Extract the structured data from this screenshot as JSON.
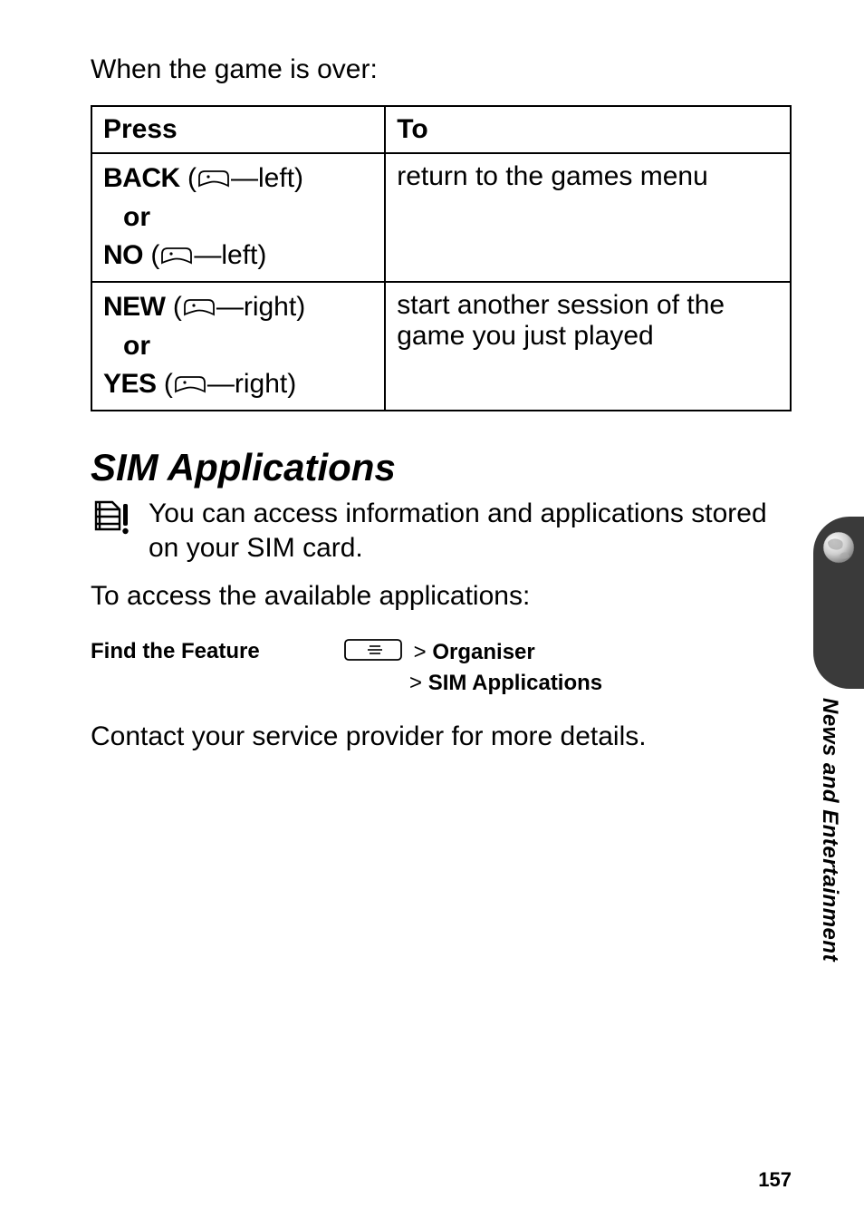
{
  "intro": "When the game is over:",
  "table": {
    "header": {
      "press": "Press",
      "to": "To"
    },
    "rows": [
      {
        "press_a": "BACK",
        "press_a_suffix": "(",
        "press_a_after": "—left)",
        "or": "or",
        "press_b": "NO",
        "press_b_suffix": "(",
        "press_b_after": "—left)",
        "to": "return to the games menu"
      },
      {
        "press_a": "NEW",
        "press_a_suffix": "(",
        "press_a_after": "—right)",
        "or": "or",
        "press_b": "YES",
        "press_b_suffix": "(",
        "press_b_after": "—right)",
        "to": "start another session of the game you just played"
      }
    ]
  },
  "section_title": "SIM Applications",
  "sim_desc": "You can access information and applications stored on your SIM card.",
  "access_line": "To access the available applications:",
  "feature": {
    "label": "Find the Feature",
    "gt": ">",
    "item1": "Organiser",
    "item2": "SIM Applications"
  },
  "contact": "Contact your service provider for more details.",
  "side_label": "News and Entertainment",
  "page_num": "157"
}
